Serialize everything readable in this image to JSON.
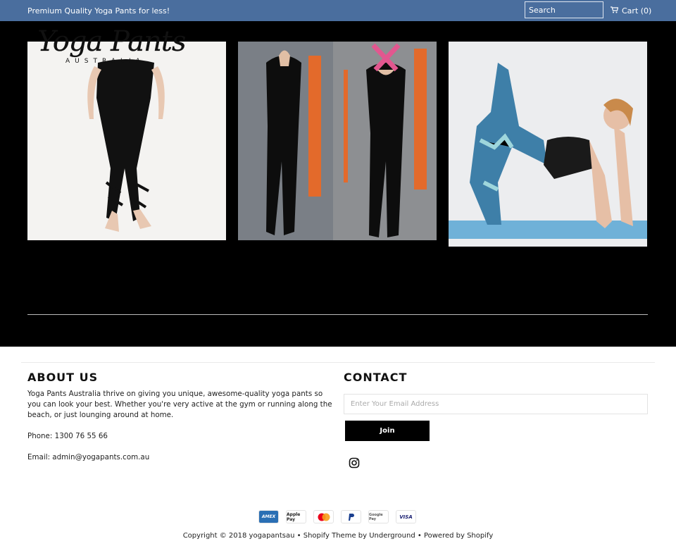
{
  "topbar": {
    "promo": "Premium Quality Yoga Pants for less!",
    "search_placeholder": "Search",
    "cart_label": "Cart (0)"
  },
  "header": {
    "logo_script": "Yoga Pants",
    "logo_sub": "AUSTRALIA"
  },
  "products": [
    {
      "name": "",
      "price": ""
    },
    {
      "name": "",
      "price": ""
    },
    {
      "name": "",
      "price": ""
    }
  ],
  "footer": {
    "about_title": "ABOUT US",
    "about_text": "Yoga Pants Australia thrive on giving you unique, awesome-quality yoga pants so you can look your best. Whether you're very active at the gym or running along the beach, or just lounging around at home.",
    "phone": "Phone: 1300 76 55 66",
    "email": "Email: admin@yogapants.com.au",
    "contact_title": "CONTACT",
    "email_placeholder": "Enter Your Email Address",
    "join_label": "Join",
    "payments": [
      "AMEX",
      "Apple Pay",
      "Mastercard",
      "PayPal",
      "Google Pay",
      "VISA"
    ],
    "copyright": "Copyright © 2018 yogapantsau • Shopify Theme by Underground • Powered by Shopify"
  },
  "icons": {
    "cart": "cart-icon",
    "instagram": "instagram-icon"
  },
  "colors": {
    "topbar": "#4a6e9e",
    "dark_bg": "#000000",
    "join_bg": "#000000"
  }
}
